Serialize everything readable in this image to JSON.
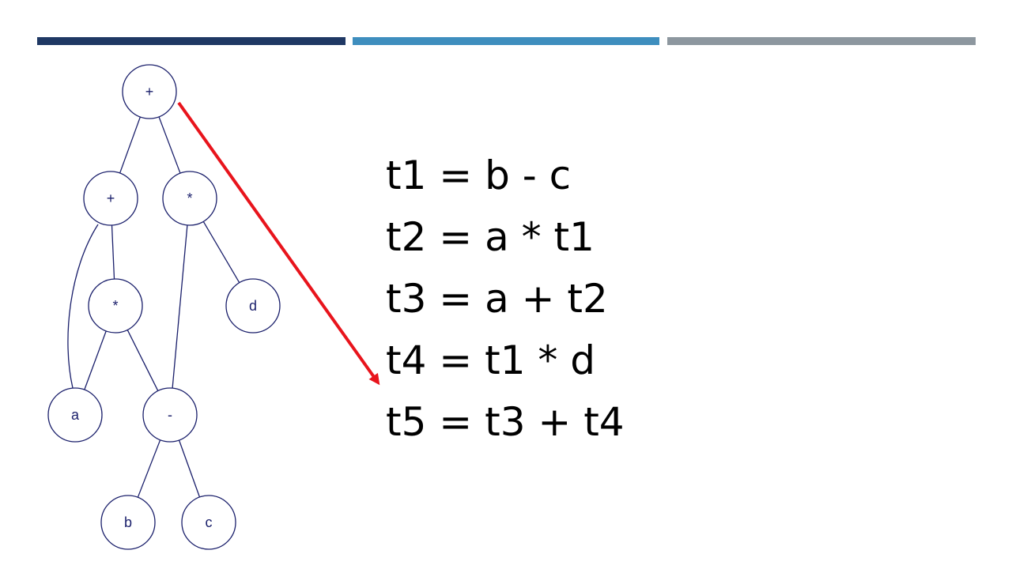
{
  "header_bars": {
    "colors": [
      "#1f3864",
      "#3e8ebe",
      "#8d979f"
    ]
  },
  "tree": {
    "node_stroke": "#1a1f6b",
    "label_color": "#1a1f6b",
    "edge_color": "#1a1f6b",
    "nodes": [
      {
        "id": "root",
        "label": "+"
      },
      {
        "id": "plus",
        "label": "+"
      },
      {
        "id": "times-right",
        "label": "*"
      },
      {
        "id": "times-left",
        "label": "*"
      },
      {
        "id": "d",
        "label": "d"
      },
      {
        "id": "a",
        "label": "a"
      },
      {
        "id": "minus",
        "label": "-"
      },
      {
        "id": "b",
        "label": "b"
      },
      {
        "id": "c",
        "label": "c"
      }
    ],
    "edges": [
      [
        "root",
        "plus"
      ],
      [
        "root",
        "times-right"
      ],
      [
        "plus",
        "a"
      ],
      [
        "plus",
        "times-left"
      ],
      [
        "times-left",
        "a"
      ],
      [
        "times-left",
        "minus"
      ],
      [
        "times-right",
        "minus"
      ],
      [
        "times-right",
        "d"
      ],
      [
        "minus",
        "b"
      ],
      [
        "minus",
        "c"
      ]
    ]
  },
  "arrow": {
    "color": "#e8141c"
  },
  "code": {
    "lines": [
      "t1 = b - c",
      "t2 = a * t1",
      "t3 = a + t2",
      "t4 = t1 * d",
      "t5 = t3 + t4"
    ]
  }
}
